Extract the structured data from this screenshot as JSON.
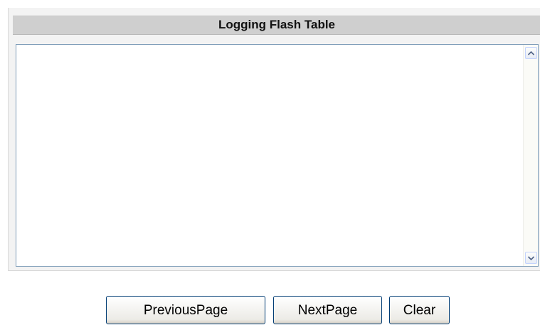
{
  "panel": {
    "title": "Logging Flash Table"
  },
  "log": {
    "content": ""
  },
  "buttons": {
    "previous_label": "PreviousPage",
    "next_label": "NextPage",
    "clear_label": "Clear"
  },
  "colors": {
    "header_bg": "#cfcfcf",
    "panel_bg": "#f3f3f3",
    "textarea_border": "#7f9db9",
    "button_border": "#003c74"
  },
  "icons": {
    "scroll_up": "scroll-up-arrow-icon",
    "scroll_down": "scroll-down-arrow-icon"
  }
}
